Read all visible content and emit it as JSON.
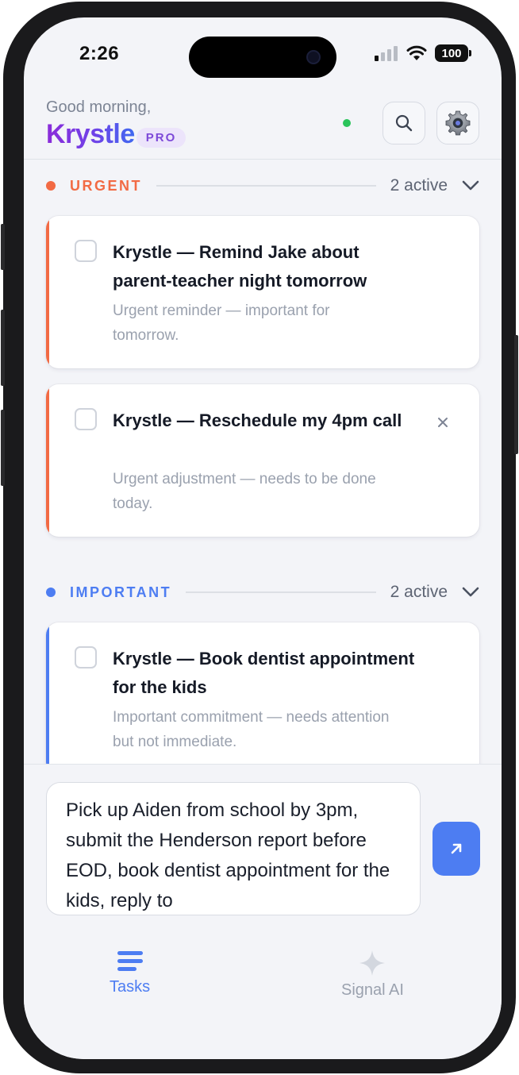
{
  "status_bar": {
    "time": "2:26",
    "battery": "100"
  },
  "header": {
    "greeting": "Good morning,",
    "user_name": "Krystle",
    "plan_badge": "PRO",
    "search_icon": "search-icon",
    "settings_icon": "gear-icon"
  },
  "colors": {
    "urgent": "#f26a44",
    "important": "#4d7df2",
    "brand_start": "#8b2bd9",
    "brand_end": "#3f69f0",
    "online": "#2bc45b"
  },
  "sections": {
    "urgent": {
      "title": "URGENT",
      "count": "2 active",
      "tasks": [
        {
          "title": "Krystle — Remind Jake about parent-teacher night tomorrow",
          "description": "Urgent reminder — important for tomorrow."
        },
        {
          "title": "Krystle — Reschedule my 4pm call",
          "description": "Urgent adjustment — needs to be done today."
        }
      ]
    },
    "important": {
      "title": "IMPORTANT",
      "count": "2 active",
      "tasks": [
        {
          "title": "Krystle — Book dentist appointment for the kids",
          "description": "Important commitment — needs attention but not immediate."
        }
      ]
    }
  },
  "composer": {
    "value": "Pick up Aiden from school by 3pm, submit the Henderson report before EOD, book dentist appointment for the kids, reply to"
  },
  "tabs": [
    {
      "label": "Tasks",
      "icon": "list-icon",
      "active": true
    },
    {
      "label": "Signal AI",
      "icon": "sparkle-icon",
      "active": false
    }
  ]
}
